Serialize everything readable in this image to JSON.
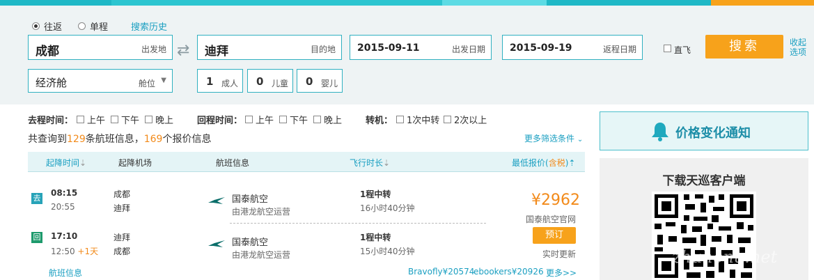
{
  "trip": {
    "round_trip": "往返",
    "one_way": "单程",
    "history_link": "搜索历史"
  },
  "search": {
    "from_value": "成都",
    "from_label": "出发地",
    "to_value": "迪拜",
    "to_label": "目的地",
    "depart_date": "2015-09-11",
    "depart_label": "出发日期",
    "return_date": "2015-09-19",
    "return_label": "返程日期",
    "direct_label": "直飞",
    "search_button": "搜索",
    "fold_label": "收起选项",
    "cabin_value": "经济舱",
    "cabin_label": "舱位",
    "adults": "1",
    "adults_label": "成人",
    "children": "0",
    "children_label": "儿童",
    "infants": "0",
    "infants_label": "婴儿"
  },
  "filters": {
    "depart_time_label": "去程时间：",
    "return_time_label": "回程时间：",
    "transfer_label": "转机：",
    "morning": "上午",
    "afternoon": "下午",
    "evening": "晚上",
    "one_stop": "1次中转",
    "two_plus": "2次以上"
  },
  "summary": {
    "prefix": "共查询到",
    "flights": "129",
    "middle": "条航班信息，",
    "quotes": "169",
    "suffix": "个报价信息",
    "more_filters": "更多筛选条件"
  },
  "table": {
    "col_time": "起降时间",
    "col_airport": "起降机场",
    "col_flight": "航班信息",
    "col_duration": "飞行时长",
    "col_price": "最低报价(",
    "col_price_tax": "含税",
    "col_price_end": ")"
  },
  "result": {
    "go_tag": "去",
    "back_tag": "回",
    "out_dep_time": "08:15",
    "out_arr_time": "20:55",
    "out_dep_airport": "成都",
    "out_arr_airport": "迪拜",
    "out_airline": "国泰航空",
    "out_operator": "由港龙航空运营",
    "out_stops": "1程中转",
    "out_duration": "16小时40分钟",
    "ret_dep_time": "17:10",
    "ret_arr_time": "12:50",
    "ret_next_day": "+1天",
    "ret_dep_airport": "迪拜",
    "ret_arr_airport": "成都",
    "ret_airline": "国泰航空",
    "ret_operator": "由港龙航空运营",
    "ret_stops": "1程中转",
    "ret_duration": "15小时40分钟",
    "price": "¥2962",
    "vendor": "国泰航空官网",
    "book_button": "预订",
    "realtime": "实时更新",
    "flight_info_link": "航班信息",
    "alt_price_1": "Bravofly¥20574",
    "alt_price_2": "ebookers¥20926",
    "more_link": "更多>>"
  },
  "sidebar": {
    "notify": "价格变化通知",
    "client_title": "下载天巡客户端"
  },
  "watermark": "zhuhong.net",
  "colors": {
    "accent": "#1fb8c6",
    "orange": "#f7a21b",
    "link": "#1a9fc1"
  }
}
